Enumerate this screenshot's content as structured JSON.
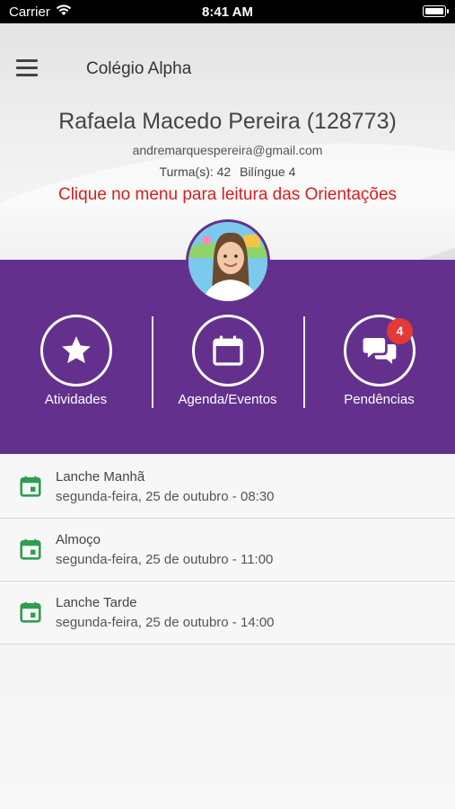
{
  "status_bar": {
    "carrier": "Carrier",
    "time": "8:41 AM"
  },
  "header": {
    "app_title": "Colégio Alpha",
    "student_name": "Rafaela Macedo Pereira (128773)",
    "email": "andremarquespereira@gmail.com",
    "class_label": "Turma(s): 42",
    "class_extra": "Bilíngue 4",
    "notice": "Clique no menu para leitura das Orientações"
  },
  "actions": {
    "activities": "Atividades",
    "agenda": "Agenda/Eventos",
    "pending": "Pendências",
    "pending_count": "4"
  },
  "events": [
    {
      "title": "Lanche Manhã",
      "when": "segunda-feira, 25 de outubro - 08:30"
    },
    {
      "title": "Almoço",
      "when": "segunda-feira, 25 de outubro - 11:00"
    },
    {
      "title": "Lanche Tarde",
      "when": "segunda-feira, 25 de outubro - 14:00"
    }
  ],
  "colors": {
    "purple": "#63318d",
    "notice_red": "#d81e1e",
    "badge_red": "#e53935",
    "calendar_green": "#2e9e4f"
  },
  "icons": {
    "menu": "hamburger-menu-icon",
    "activities": "star-icon",
    "agenda": "calendar-icon",
    "pending": "chat-bubbles-icon",
    "event": "calendar-green-icon"
  }
}
